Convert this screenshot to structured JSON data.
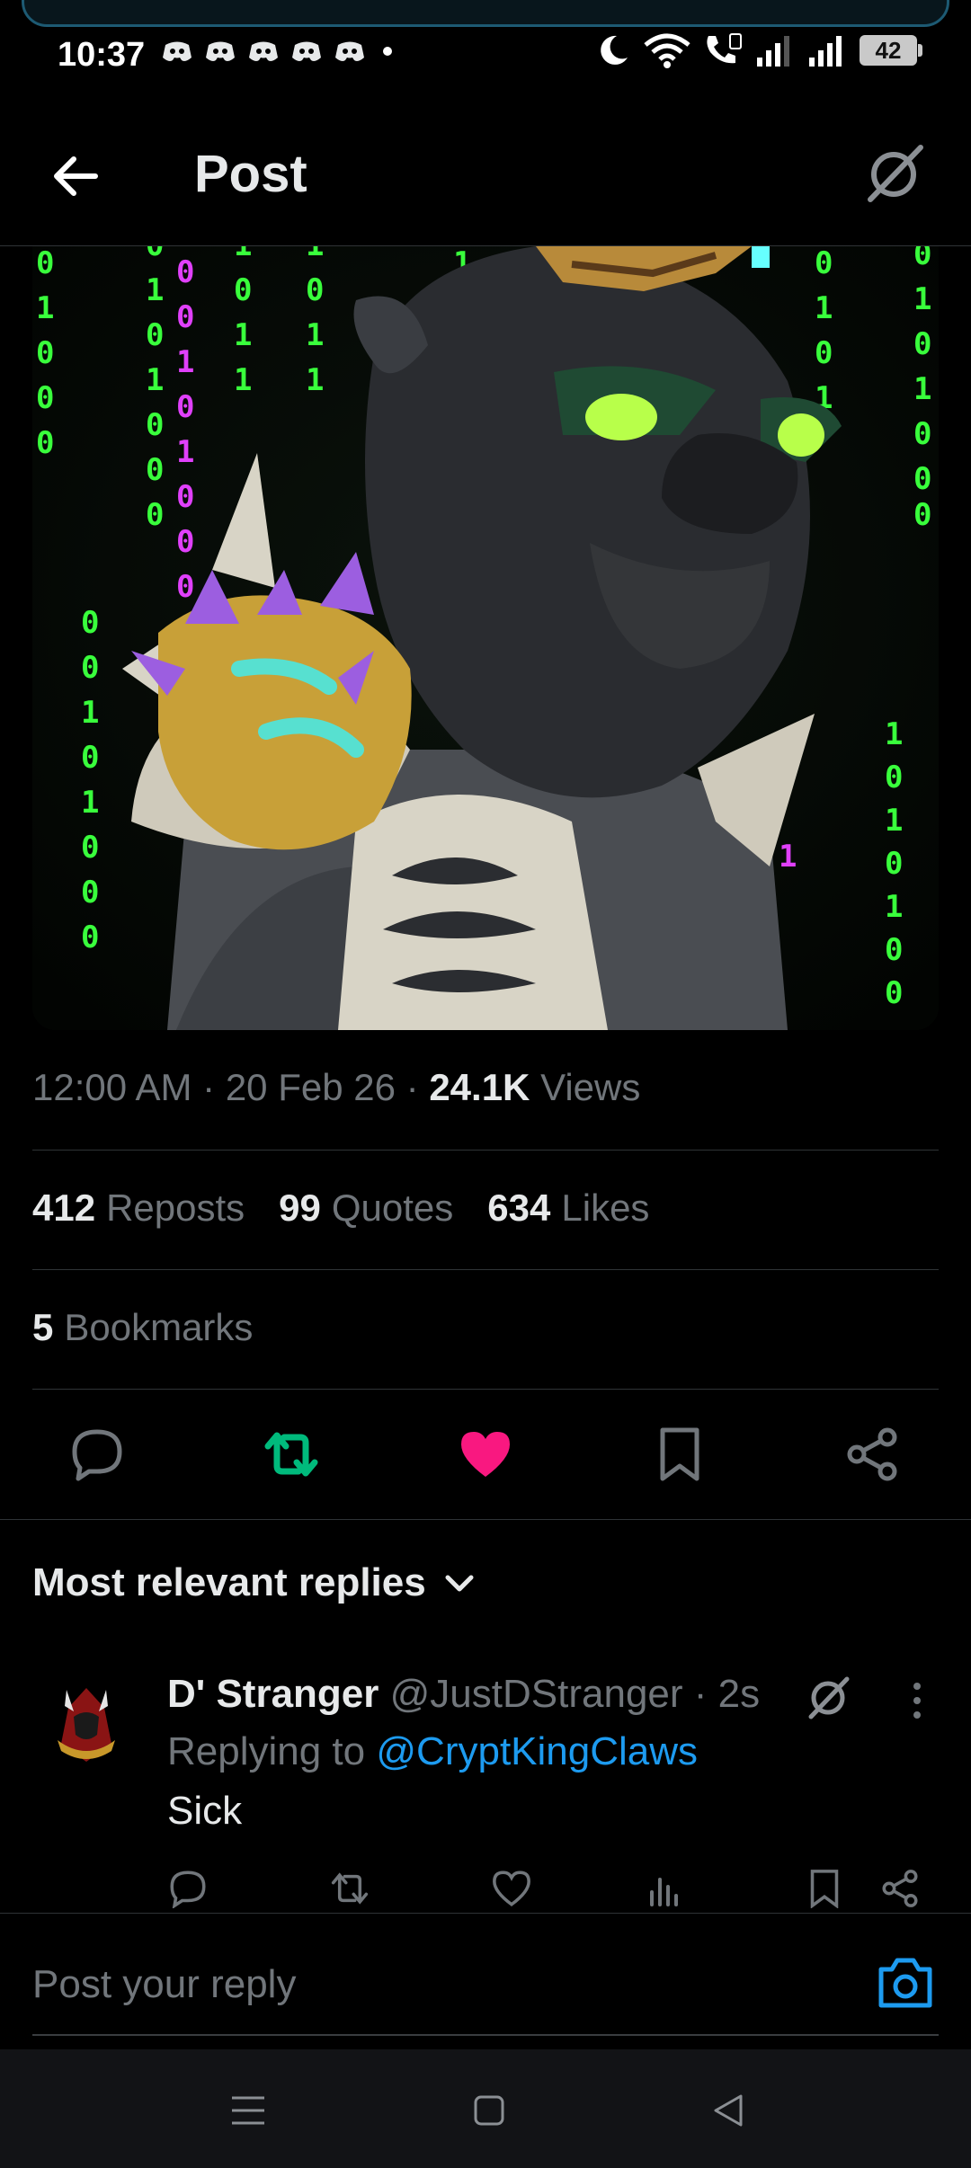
{
  "status_bar": {
    "time": "10:37",
    "battery": "42",
    "notification_icons": [
      "discord-icon",
      "discord-icon",
      "discord-icon",
      "discord-icon",
      "discord-icon"
    ],
    "system_icons": [
      "moon-icon",
      "wifi-icon",
      "volte-call-icon",
      "signal-icon",
      "signal-icon",
      "battery-icon"
    ]
  },
  "header": {
    "title": "Post",
    "back_icon": "arrow-left-icon",
    "grok_icon": "grok-icon"
  },
  "post": {
    "time": "12:00 AM",
    "date": "20 Feb 26",
    "views_count": "24.1K",
    "views_label": "Views",
    "separator": "·",
    "stats": [
      {
        "count": "412",
        "label": "Reposts"
      },
      {
        "count": "99",
        "label": "Quotes"
      },
      {
        "count": "634",
        "label": "Likes"
      }
    ],
    "bookmarks": {
      "count": "5",
      "label": "Bookmarks"
    },
    "accent_colors": {
      "repost": "#00ba7c",
      "like": "#f91880",
      "link": "#1d9bf0"
    }
  },
  "replies": {
    "sort_label": "Most relevant replies",
    "items": [
      {
        "name": "D' Stranger",
        "handle": "@JustDStranger",
        "time": "· 2s",
        "replying_prefix": "Replying to",
        "replying_to": "@CryptKingClaws",
        "text": "Sick"
      }
    ]
  },
  "compose": {
    "placeholder": "Post your reply"
  }
}
